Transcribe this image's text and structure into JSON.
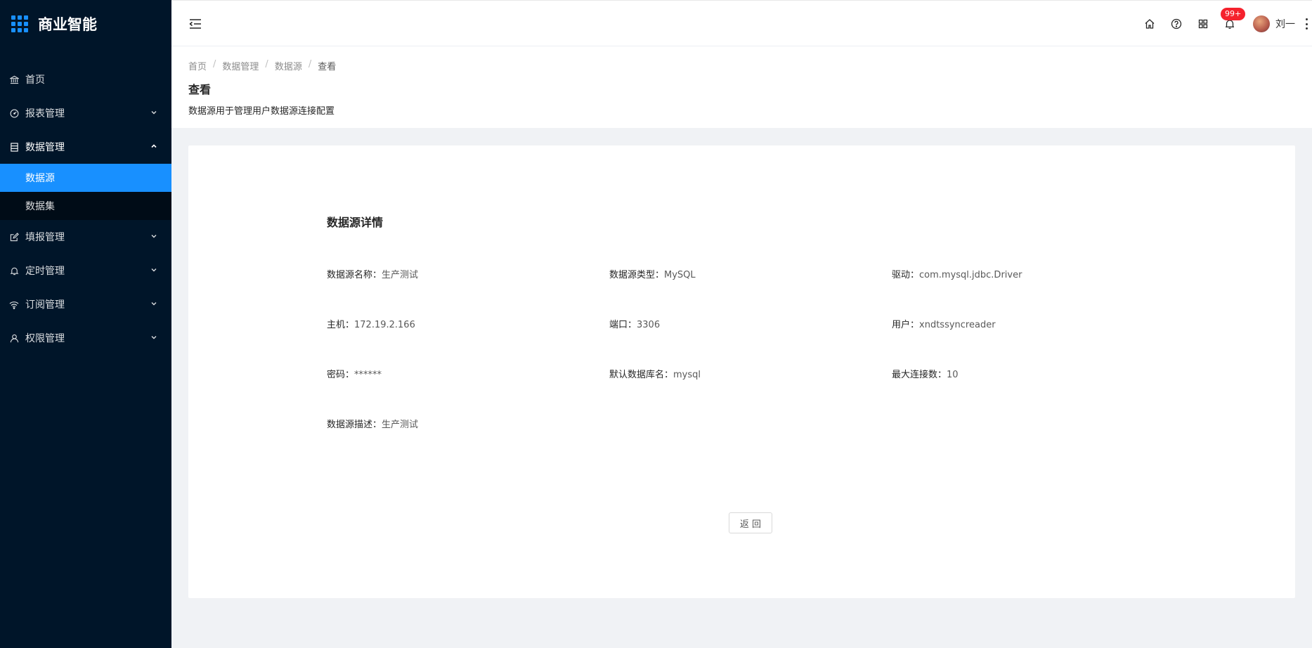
{
  "app": {
    "title": "商业智能"
  },
  "sidebar": {
    "items": [
      {
        "label": "首页",
        "icon": "bank-icon"
      },
      {
        "label": "报表管理",
        "icon": "dashboard-icon"
      },
      {
        "label": "数据管理",
        "icon": "database-icon",
        "open": true,
        "children": [
          {
            "label": "数据源",
            "active": true
          },
          {
            "label": "数据集"
          }
        ]
      },
      {
        "label": "填报管理",
        "icon": "edit-icon"
      },
      {
        "label": "定时管理",
        "icon": "bell-icon"
      },
      {
        "label": "订阅管理",
        "icon": "wifi-icon"
      },
      {
        "label": "权限管理",
        "icon": "user-icon"
      }
    ]
  },
  "header": {
    "notification_badge": "99+",
    "username": "刘一"
  },
  "breadcrumb": [
    "首页",
    "数据管理",
    "数据源",
    "查看"
  ],
  "page": {
    "title": "查看",
    "description": "数据源用于管理用户数据源连接配置"
  },
  "detail": {
    "section_title": "数据源详情",
    "fields": [
      {
        "label": "数据源名称：",
        "value": "生产测试"
      },
      {
        "label": "数据源类型：",
        "value": "MySQL"
      },
      {
        "label": "驱动：",
        "value": "com.mysql.jdbc.Driver"
      },
      {
        "label": "主机：",
        "value": "172.19.2.166"
      },
      {
        "label": "端口：",
        "value": "3306"
      },
      {
        "label": "用户：",
        "value": "xndtssyncreader"
      },
      {
        "label": "密码：",
        "value": "******"
      },
      {
        "label": "默认数据库名：",
        "value": "mysql"
      },
      {
        "label": "最大连接数：",
        "value": "10"
      },
      {
        "label": "数据源描述：",
        "value": "生产测试"
      }
    ],
    "back_label": "返 回"
  },
  "colors": {
    "sidebar_bg": "#001529",
    "accent": "#1890ff",
    "badge": "#f5222d"
  }
}
